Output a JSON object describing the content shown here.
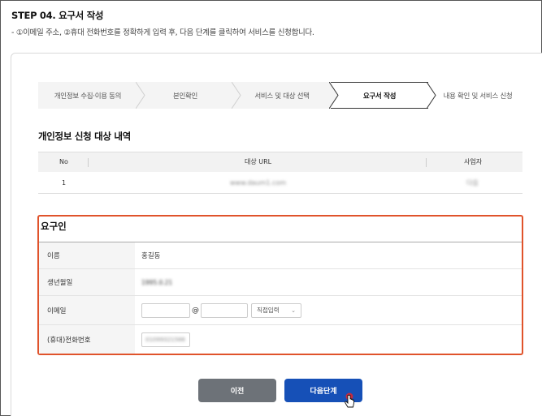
{
  "header": {
    "step_title": "STEP 04. 요구서 작성",
    "description": "- ①이메일 주소, ②휴대 전화번호를 정확하게 입력 후, 다음 단계를 클릭하여 서비스를 신청합니다."
  },
  "steps": [
    {
      "label": "개인정보 수집·이용 동의",
      "state": "done"
    },
    {
      "label": "본인확인",
      "state": "done"
    },
    {
      "label": "서비스 및 대상 선택",
      "state": "done"
    },
    {
      "label": "요구서 작성",
      "state": "active"
    },
    {
      "label": "내용 확인 및 서비스 신청",
      "state": "pending"
    }
  ],
  "target_section": {
    "title": "개인정보 신청 대상 내역",
    "columns": {
      "no": "No",
      "url": "대상 URL",
      "company": "사업자"
    },
    "rows": [
      {
        "no": "1",
        "url": "www.daum1.com",
        "company": "다음"
      }
    ]
  },
  "requester": {
    "title": "요구인",
    "name_label": "이름",
    "name_value": "홍길동",
    "birth_label": "생년월일",
    "birth_value": "1995.0.21",
    "email_label": "이메일",
    "email_at": "@",
    "email_select": "직접입력",
    "phone_label": "(휴대)전화번호",
    "phone_value": "01099321566"
  },
  "buttons": {
    "prev": "이전",
    "next": "다음단계"
  },
  "colors": {
    "accent_blue": "#1650b7",
    "highlight_border": "#e0532b",
    "prev_gray": "#6d7278"
  }
}
